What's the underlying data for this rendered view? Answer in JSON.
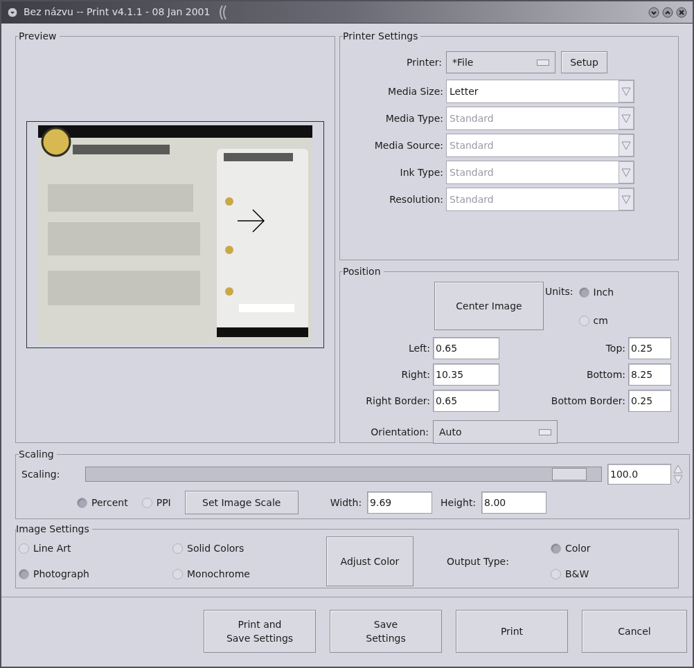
{
  "window": {
    "title": "Bez názvu -- Print v4.1.1 - 08 Jan 2001"
  },
  "preview": {
    "title": "Preview"
  },
  "printer_settings": {
    "title": "Printer Settings",
    "printer": {
      "label": "Printer:",
      "value": "*File",
      "button": "Setup"
    },
    "options": [
      {
        "label": "Media Size:",
        "value": "Letter",
        "disabled": false
      },
      {
        "label": "Media Type:",
        "value": "Standard",
        "disabled": true
      },
      {
        "label": "Media Source:",
        "value": "Standard",
        "disabled": true
      },
      {
        "label": "Ink Type:",
        "value": "Standard",
        "disabled": true
      },
      {
        "label": "Resolution:",
        "value": "Standard",
        "disabled": true
      }
    ]
  },
  "position": {
    "title": "Position",
    "center_button": "Center Image",
    "units_label": "Units:",
    "units": [
      {
        "label": "Inch",
        "selected": true
      },
      {
        "label": "cm",
        "selected": false
      }
    ],
    "fields": [
      {
        "label": "Left:",
        "value": "0.65"
      },
      {
        "label": "Top:",
        "value": "0.25"
      },
      {
        "label": "Right:",
        "value": "10.35"
      },
      {
        "label": "Bottom:",
        "value": "8.25"
      },
      {
        "label": "Right Border:",
        "value": "0.65"
      },
      {
        "label": "Bottom Border:",
        "value": "0.25"
      }
    ],
    "orientation": {
      "label": "Orientation:",
      "value": "Auto"
    }
  },
  "scaling": {
    "title": "Scaling",
    "label": "Scaling:",
    "level": 0.97,
    "value": "100.0",
    "modes": [
      {
        "label": "Percent",
        "selected": true
      },
      {
        "label": "PPI",
        "selected": false
      }
    ],
    "set_button": "Set Image Scale",
    "width": {
      "label": "Width:",
      "value": "9.69"
    },
    "height": {
      "label": "Height:",
      "value": "8.00"
    }
  },
  "image_settings": {
    "title": "Image Settings",
    "image_types": [
      {
        "label": "Line Art",
        "selected": false
      },
      {
        "label": "Solid Colors",
        "selected": false
      },
      {
        "label": "Photograph",
        "selected": true
      },
      {
        "label": "Monochrome",
        "selected": false
      }
    ],
    "adjust_button": "Adjust Color",
    "output_label": "Output Type:",
    "output_types": [
      {
        "label": "Color",
        "selected": true
      },
      {
        "label": "B&W",
        "selected": false
      }
    ]
  },
  "buttons": [
    "Print and\nSave Settings",
    "Save\nSettings",
    "Print",
    "Cancel"
  ]
}
